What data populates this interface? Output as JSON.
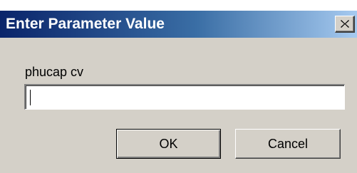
{
  "dialog": {
    "title": "Enter Parameter Value",
    "close_glyph": "✕",
    "prompt": "phucap cv",
    "input_value": "",
    "ok_label": "OK",
    "cancel_label": "Cancel"
  },
  "colors": {
    "title_start": "#0a246a",
    "title_end": "#a6caf0",
    "dialog_bg": "#d4d0c8"
  }
}
